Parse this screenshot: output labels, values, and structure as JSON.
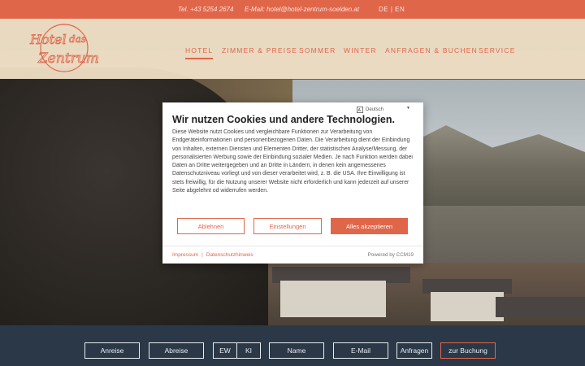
{
  "topbar": {
    "phone": "Tel. +43 5254 2674",
    "email": "E-Mail: hotel@hotel-zentrum-soelden.at",
    "lang_de": "DE",
    "lang_sep": "|",
    "lang_en": "EN"
  },
  "logo": {
    "line1": "Hotel",
    "line2": "das",
    "line3": "Zentrum"
  },
  "nav": {
    "items": [
      "HOTEL",
      "ZIMMER & PREISE",
      "SOMMER",
      "WINTER",
      "ANFRAGEN & BUCHEN",
      "SERVICE"
    ],
    "active": "HOTEL"
  },
  "booking": {
    "arrival": "Anreise",
    "departure": "Abreise",
    "adults": "EW",
    "children": "KI",
    "name": "Name",
    "email": "E-Mail",
    "inquire": "Anfragen",
    "book": "zur Buchung"
  },
  "cookie": {
    "language": "Deutsch",
    "title": "Wir nutzen Cookies und andere Technologien.",
    "body": "Diese Website nutzt Cookies und vergleichbare Funktionen zur Verarbeitung von Endgeräteinformationen und personenbezogenen Daten. Die Verarbeitung dient der Einbindung von Inhalten, externen Diensten und Elementen Dritter, der statistischen Analyse/Messung, der personalisierten Werbung sowie der Einbindung sozialer Medien. Je nach Funktion werden dabei Daten an Dritte weitergegeben und an Dritte in Ländern, in denen kein angemessenes Datenschutzniveau vorliegt und von dieser verarbeitet wird, z. B. die USA. Ihre Einwilligung ist stets freiwillig, für die Nutzung unserer Website nicht erforderlich und kann jederzeit auf unserer Seite abgelehnt od widerrufen werden.",
    "reject": "Ablehnen",
    "settings": "Einstellungen",
    "accept_all": "Alles akzeptieren",
    "imprint": "Impressum",
    "footer_sep": "|",
    "privacy": "Datenschutzhinweis",
    "powered": "Powered by CCM19"
  },
  "colors": {
    "accent": "#e0664a",
    "header_bg": "#f5e5ca",
    "booking_bg": "#2b3847"
  }
}
